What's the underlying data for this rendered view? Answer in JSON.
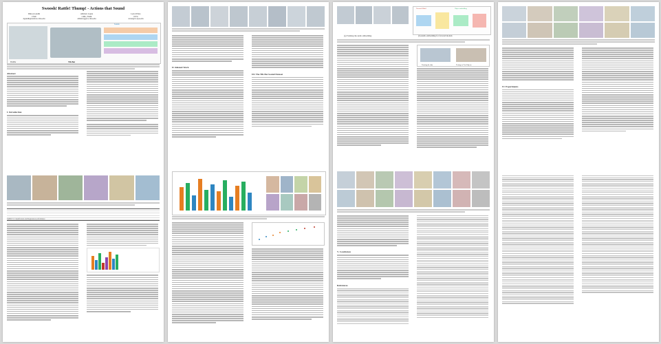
{
  "paper": {
    "title": "Swoosh! Rattle! Thump! - Actions that Sound",
    "authors": [
      {
        "name": "Dhiraj Gandhi",
        "affil": "CMU",
        "email": "dgandhi@andrew.cmu.edu"
      },
      {
        "name": "Abhinav Gupta",
        "affil": "CMU, FAIR",
        "email": "abhinavg@cs.cmu.edu"
      },
      {
        "name": "Lerrel Pinto",
        "affil": "NYU",
        "email": "lerrel@cs.nyu.edu"
      }
    ],
    "abstract_label": "Abstract",
    "figure_labels": {
      "fig1_a": "Tilt-Bot",
      "fig1_b": "Sounds",
      "fig1_c": "Tilt-Bot",
      "fig3_a": "(a) Training the audio embedding",
      "fig3_b": "(b) Audio embedding for forward models",
      "p3_a": "Forward Model",
      "p3_b": "Object embedding",
      "fig_c_left": "Training the data",
      "fig_c_right": "Testing on Test Objects"
    },
    "sections": {
      "intro": "I. Introduction",
      "related": "II. Related Work",
      "dataset": "III. The Tilt-Bot Sound Dataset",
      "results": "IV. Experiments",
      "conclusion": "V. Conclusion",
      "references": "References"
    },
    "table_caption": "TABLE I: Classification and Regression performance",
    "accent_colors": [
      "#e67e22",
      "#2e86c1",
      "#27ae60",
      "#c0392b",
      "#8e44ad"
    ]
  }
}
